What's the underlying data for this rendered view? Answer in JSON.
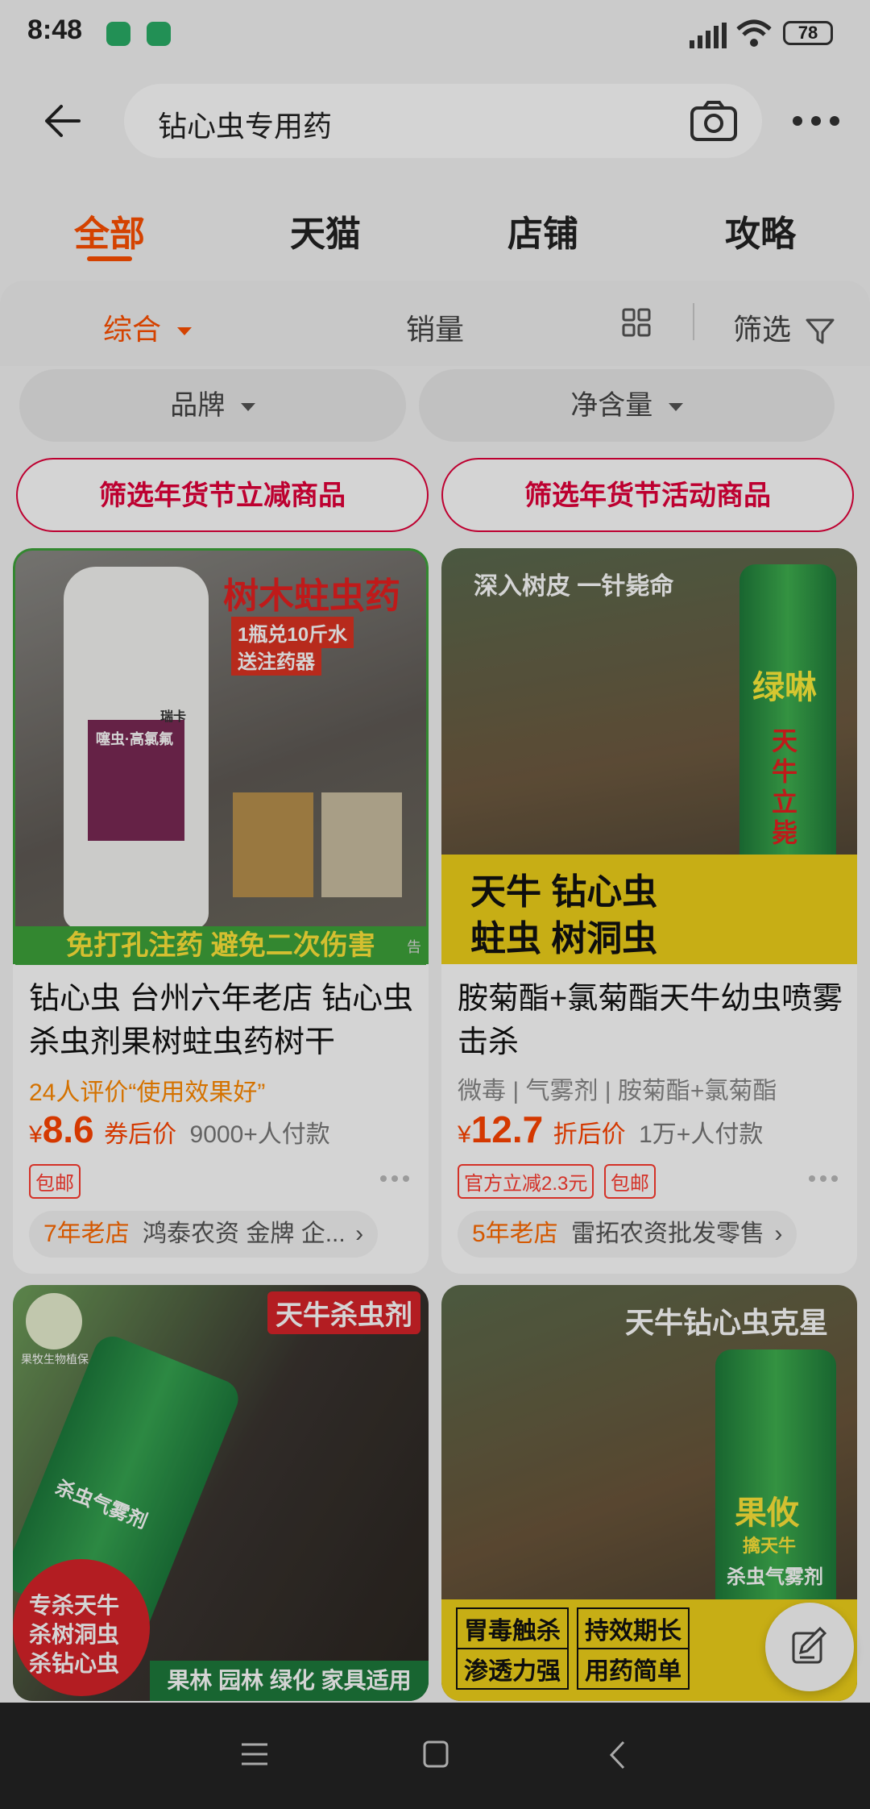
{
  "status": {
    "time": "8:48",
    "battery": "78"
  },
  "search": {
    "query": "钻心虫专用药"
  },
  "tabs": [
    {
      "label": "全部",
      "active": true
    },
    {
      "label": "天猫"
    },
    {
      "label": "店铺"
    },
    {
      "label": "攻略"
    }
  ],
  "sort": {
    "default": "综合",
    "sales": "销量",
    "filter": "筛选"
  },
  "chips": {
    "brand": "品牌",
    "volume": "净含量"
  },
  "promos": [
    "筛选年货节立减商品",
    "筛选年货节活动商品"
  ],
  "products": [
    {
      "image_text": {
        "headline": "树木蛀虫药",
        "sub1": "1瓶兑10斤水",
        "sub2": "送注药器",
        "bottom": "免打孔注药 避免二次伤害",
        "ad": "告",
        "bottle_brand": "瑞卡",
        "bottle_label": "噻虫·高氯氟"
      },
      "title": "钻心虫 台州六年老店 钻心虫杀虫剂果树蛀虫药树干",
      "review": "24人评价“使用效果好”",
      "currency": "¥",
      "price": "8.6",
      "price_note": "券后价",
      "sold": "9000+人付款",
      "tags": [
        "包邮"
      ],
      "store_age": "7年老店",
      "store_name": "鸿泰农资 金牌 企..."
    },
    {
      "image_text": {
        "headline": "深入树皮 一针毙命",
        "line1": "天牛  钻心虫",
        "line2": "蛀虫  树洞虫",
        "can_text": "绿啉",
        "can_sub": "天牛立毙"
      },
      "title": "胺菊酯+氯菊酯天牛幼虫喷雾击杀",
      "attrs": "微毒 | 气雾剂 | 胺菊酯+氯菊酯",
      "currency": "¥",
      "price": "12.7",
      "price_note": "折后价",
      "sold": "1万+人付款",
      "tags": [
        "官方立减2.3元",
        "包邮"
      ],
      "store_age": "5年老店",
      "store_name": "雷拓农资批发零售"
    },
    {
      "image_text": {
        "headline": "天牛杀虫剂",
        "can_text": "杀虫气雾剂",
        "badge1": "专杀天牛",
        "badge2": "杀树洞虫",
        "badge3": "杀钻心虫",
        "bottom": "果林 园林 绿化 家具适用",
        "logo": "果牧生物植保"
      }
    },
    {
      "image_text": {
        "headline": "天牛钻心虫克星",
        "can_brand": "果攸",
        "can_sub": "擒天牛",
        "can_text": "杀虫气雾剂",
        "f1": "胃毒触杀",
        "f2": "持效期长",
        "f3": "渗透力强",
        "f4": "用药简单"
      }
    }
  ]
}
